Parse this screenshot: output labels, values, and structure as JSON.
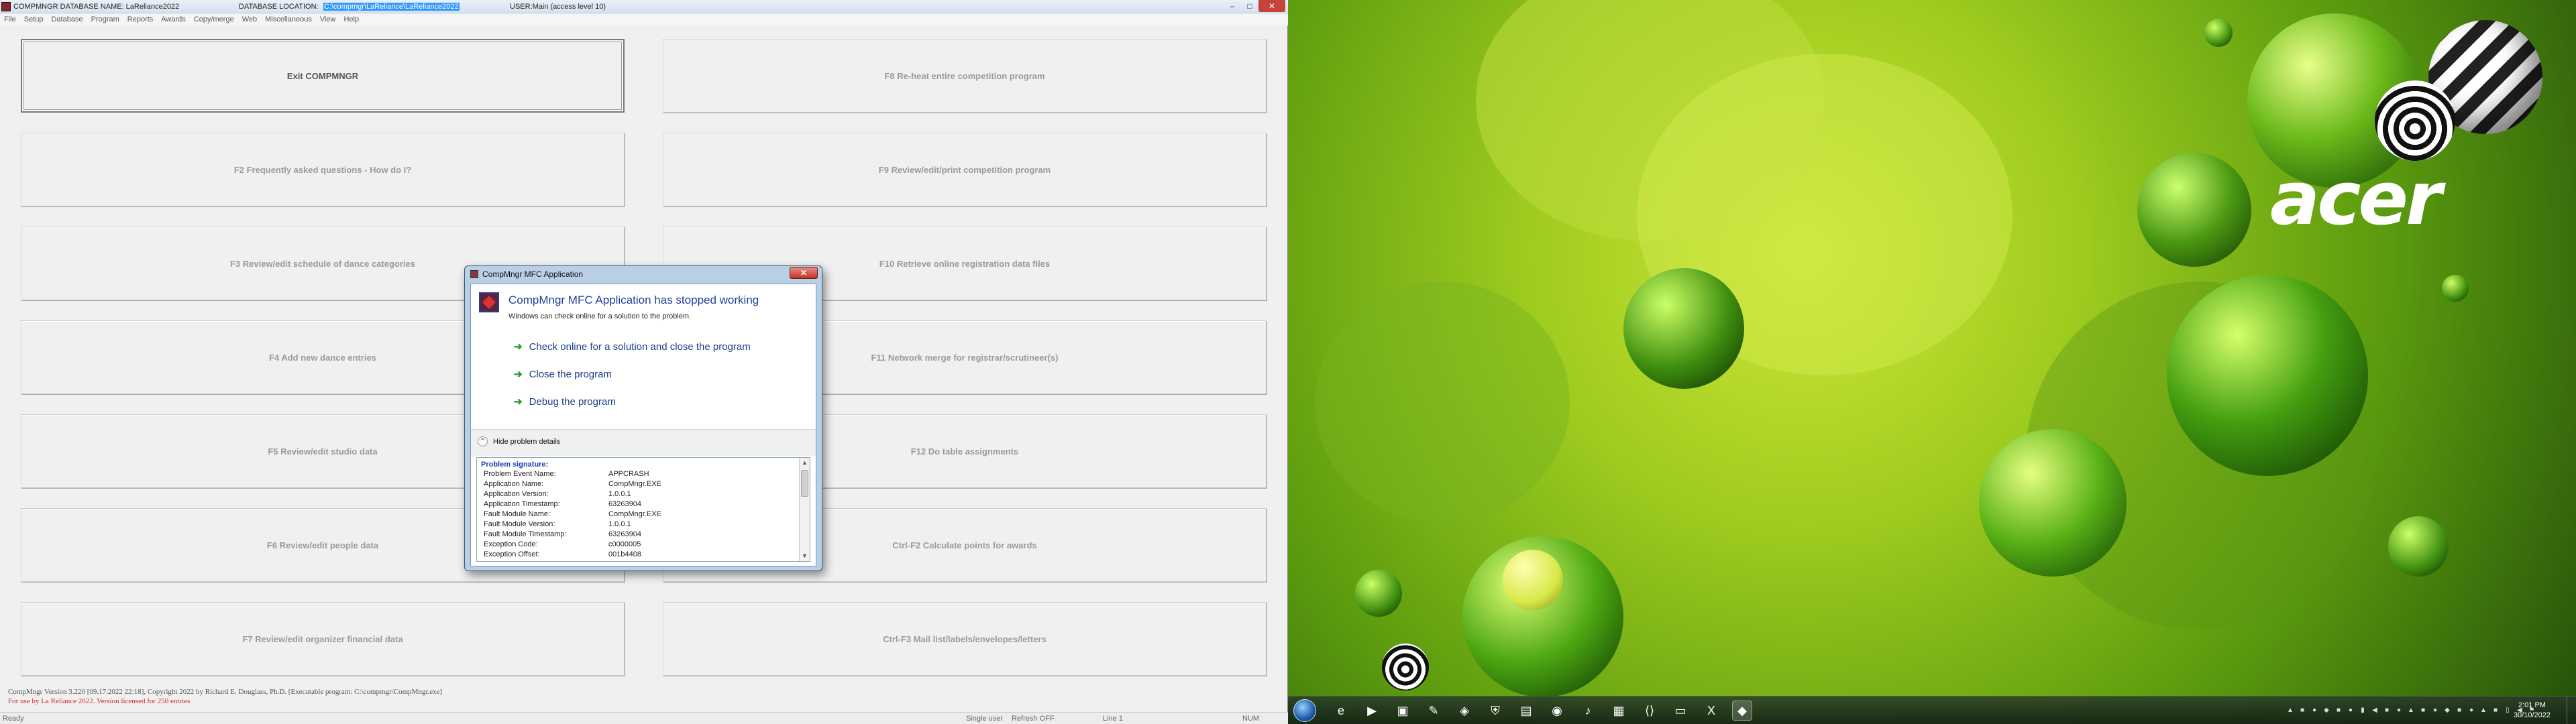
{
  "app": {
    "title_prefix": "COMPMNGR DATABASE NAME: LaReliance2022",
    "title_location_label": "DATABASE LOCATION:",
    "title_location_value": "C:\\compmgr\\LaReliance\\LaReliance2022",
    "title_user": "USER:Main (access level 10)",
    "window_buttons": {
      "minimize": "–",
      "maximize": "□",
      "close": "✕"
    }
  },
  "menu": [
    "File",
    "Setup",
    "Database",
    "Program",
    "Reports",
    "Awards",
    "Copy/merge",
    "Web",
    "Miscellaneous",
    "View",
    "Help"
  ],
  "function_buttons": [
    "Exit COMPMNGR",
    "F8 Re-heat entire competition program",
    "F2 Frequently asked questions - How do I?",
    "F9 Review/edit/print competition program",
    "F3 Review/edit schedule of dance categories",
    "F10 Retrieve online registration data files",
    "F4 Add new dance entries",
    "F11 Network merge for registrar/scrutineer(s)",
    "F5 Review/edit studio data",
    "F12 Do table assignments",
    "F6 Review/edit people data",
    "Ctrl-F2 Calculate points for awards",
    "F7 Review/edit organizer financial data",
    "Ctrl-F3 Mail list/labels/envelopes/letters"
  ],
  "status": {
    "line1": "CompMngr Version 3.220 [09.17.2022 22:18], Copyright 2022 by Richard E. Douglass, Ph.D. [Executable program: C:\\compmgr\\CompMngr.exe]",
    "line2": "For use by La Reliance 2022. Version licensed for 250 entries",
    "ready": "Ready",
    "single_user": "Single user",
    "refresh": "Refresh OFF",
    "line": "Line 1",
    "num": "NUM"
  },
  "dialog": {
    "title": "CompMngr MFC Application",
    "close": "✕",
    "heading": "CompMngr MFC Application has stopped working",
    "subtext": "Windows can check online for a solution to the problem.",
    "options": [
      "Check online for a solution and close the program",
      "Close the program",
      "Debug the program"
    ],
    "hide_details": "Hide problem details",
    "signature_heading": "Problem signature:",
    "signature": [
      {
        "k": "Problem Event Name:",
        "v": "APPCRASH"
      },
      {
        "k": "Application Name:",
        "v": "CompMngr.EXE"
      },
      {
        "k": "Application Version:",
        "v": "1.0.0.1"
      },
      {
        "k": "Application Timestamp:",
        "v": "63263904"
      },
      {
        "k": "Fault Module Name:",
        "v": "CompMngr.EXE"
      },
      {
        "k": "Fault Module Version:",
        "v": "1.0.0.1"
      },
      {
        "k": "Fault Module Timestamp:",
        "v": "63263904"
      },
      {
        "k": "Exception Code:",
        "v": "c0000005"
      },
      {
        "k": "Exception Offset:",
        "v": "001b4408"
      }
    ]
  },
  "desktop": {
    "brand": "acer",
    "clock_time": "2:01 PM",
    "clock_date": "30/10/2022"
  },
  "colors": {
    "accent": "#1e3f9a",
    "error_red": "#d02020",
    "desktop_green": "#9fcc1f"
  }
}
